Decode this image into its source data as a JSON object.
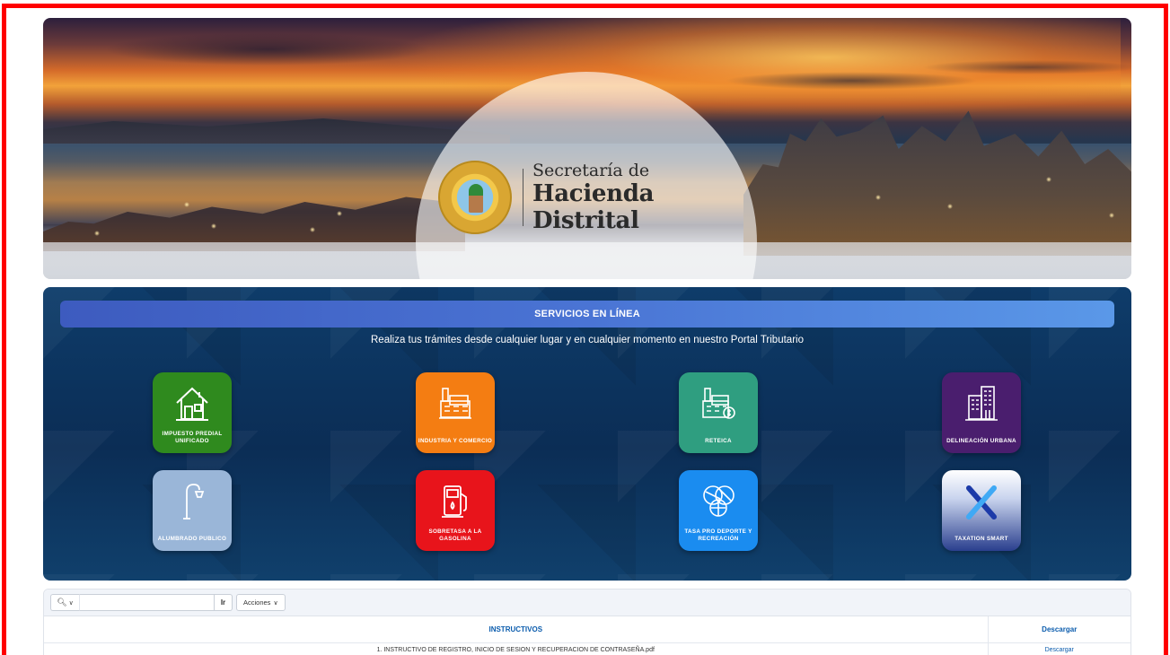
{
  "banner": {
    "brand_line1": "Secretaría de",
    "brand_line2": "Hacienda Distrital"
  },
  "services": {
    "title": "SERVICIOS EN LÍNEA",
    "subtitle": "Realiza tus trámites desde cualquier lugar y en cualquier momento en nuestro Portal Tributario",
    "tiles": [
      {
        "label": "IMPUESTO PREDIAL UNIFICADO",
        "icon": "house-icon",
        "color": "#2f8a1e"
      },
      {
        "label": "INDUSTRIA Y COMERCIO",
        "icon": "factory-icon",
        "color": "#f47d12"
      },
      {
        "label": "RETEICA",
        "icon": "factory-money-icon",
        "color": "#2f9e80"
      },
      {
        "label": "DELINEACIÓN URBANA",
        "icon": "buildings-icon",
        "color": "#4a1e6e"
      },
      {
        "label": "ALUMBRADO PUBLICO",
        "icon": "street-lamp-icon",
        "color": "#9ab6d8"
      },
      {
        "label": "SOBRETASA A LA GASOLINA",
        "icon": "fuel-pump-icon",
        "color": "#e8141b"
      },
      {
        "label": "TASA PRO DEPORTE Y RECREACIÓN",
        "icon": "sports-balls-icon",
        "color": "#1a8cf0"
      },
      {
        "label": "TAXATION SMART",
        "icon": "x-logo-icon",
        "color": "#2a3f8e"
      }
    ]
  },
  "report": {
    "go_label": "Ir",
    "actions_label": "Acciones",
    "columns": [
      "INSTRUCTIVOS",
      "Descargar"
    ],
    "rows": [
      {
        "name": "1. INSTRUCTIVO DE REGISTRO, INICIO DE SESION Y RECUPERACION DE CONTRASEÑA.pdf",
        "link": "Descargar"
      }
    ]
  }
}
